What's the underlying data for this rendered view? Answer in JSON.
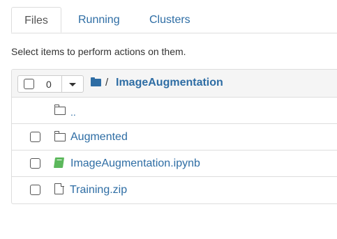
{
  "tabs": [
    {
      "label": "Files",
      "active": true
    },
    {
      "label": "Running",
      "active": false
    },
    {
      "label": "Clusters",
      "active": false
    }
  ],
  "instructions": "Select items to perform actions on them.",
  "toolbar": {
    "selected_count": "0",
    "path_separator": "/",
    "current_dir": "ImageAugmentation"
  },
  "parent_dir": {
    "label": "..",
    "icon": "folder-icon"
  },
  "items": [
    {
      "name": "Augmented",
      "type": "folder",
      "icon": "folder-icon"
    },
    {
      "name": "ImageAugmentation.ipynb",
      "type": "notebook",
      "icon": "notebook-icon"
    },
    {
      "name": "Training.zip",
      "type": "file",
      "icon": "file-icon"
    }
  ],
  "colors": {
    "link": "#2e6da4",
    "notebook_icon": "#5cb85c",
    "border": "#dddddd",
    "header_bg": "#f5f5f5"
  }
}
